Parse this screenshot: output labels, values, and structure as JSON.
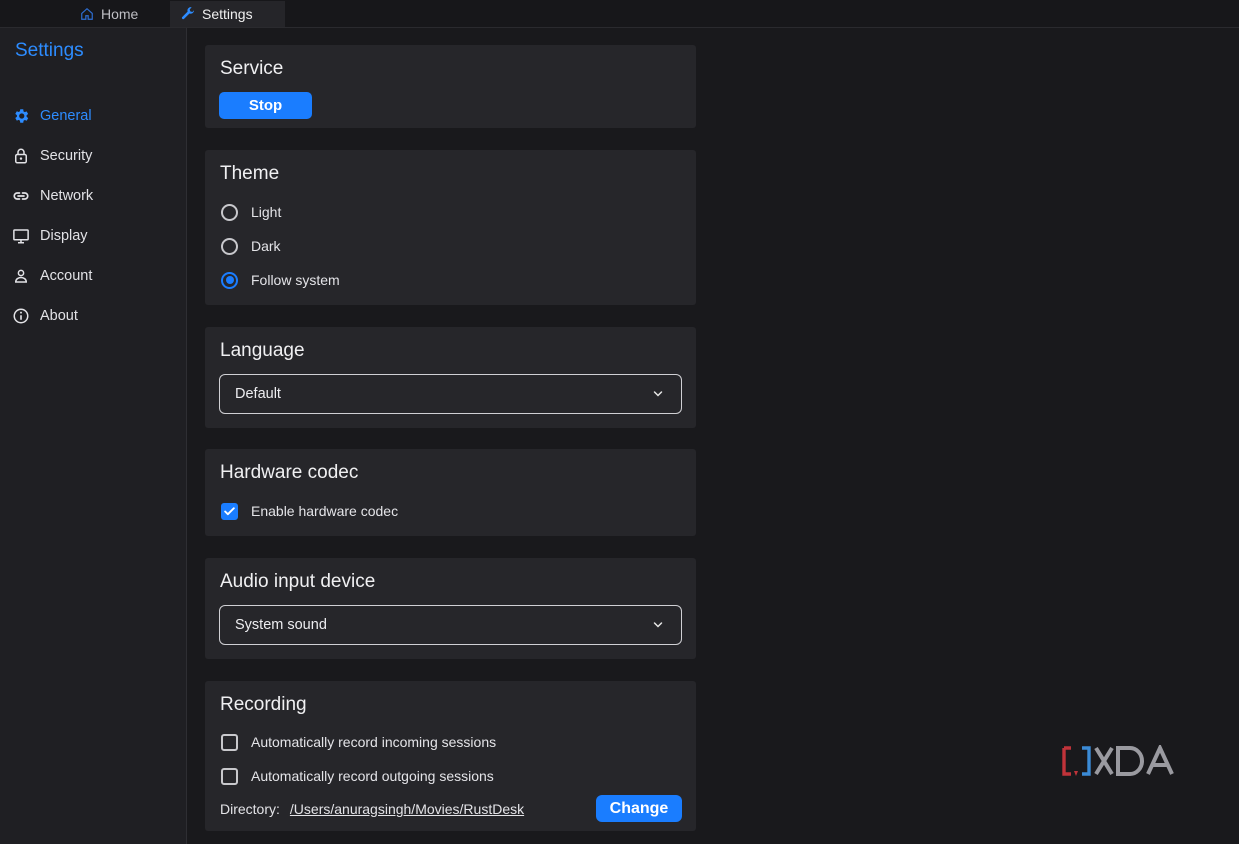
{
  "tabs": [
    {
      "label": "Home",
      "icon": "home-icon"
    },
    {
      "label": "Settings",
      "icon": "wrench-icon"
    }
  ],
  "sidebar": {
    "title": "Settings",
    "items": [
      {
        "label": "General",
        "icon": "gear-icon",
        "active": true
      },
      {
        "label": "Security",
        "icon": "lock-icon"
      },
      {
        "label": "Network",
        "icon": "link-icon"
      },
      {
        "label": "Display",
        "icon": "monitor-icon"
      },
      {
        "label": "Account",
        "icon": "person-icon"
      },
      {
        "label": "About",
        "icon": "info-icon"
      }
    ]
  },
  "service": {
    "title": "Service",
    "button": "Stop"
  },
  "theme": {
    "title": "Theme",
    "options": [
      "Light",
      "Dark",
      "Follow system"
    ],
    "selected": "Follow system"
  },
  "language": {
    "title": "Language",
    "value": "Default"
  },
  "hardware_codec": {
    "title": "Hardware codec",
    "option": "Enable hardware codec",
    "checked": true
  },
  "audio": {
    "title": "Audio input device",
    "value": "System sound"
  },
  "recording": {
    "title": "Recording",
    "options": [
      "Automatically record incoming sessions",
      "Automatically record outgoing sessions"
    ],
    "directory_label": "Directory:",
    "directory_path": "/Users/anuragsingh/Movies/RustDesk",
    "change_button": "Change"
  },
  "watermark": "XDA",
  "colors": {
    "accent": "#1a7dff",
    "background": "#19191c",
    "card": "#26262a"
  }
}
